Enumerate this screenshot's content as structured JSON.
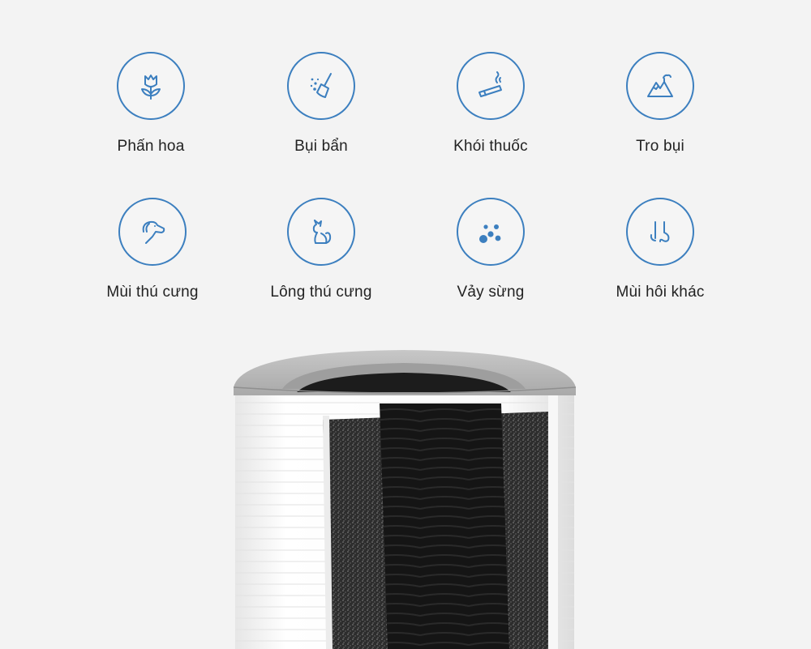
{
  "features": [
    {
      "label": "Phấn hoa",
      "icon": "flower-icon"
    },
    {
      "label": "Bụi bẩn",
      "icon": "broom-dust-icon"
    },
    {
      "label": "Khói thuốc",
      "icon": "cigarette-icon"
    },
    {
      "label": "Tro bụi",
      "icon": "mountain-ash-icon"
    },
    {
      "label": "Mùi thú cưng",
      "icon": "dog-icon"
    },
    {
      "label": "Lông thú cưng",
      "icon": "cat-icon"
    },
    {
      "label": "Vảy sừng",
      "icon": "particles-icon"
    },
    {
      "label": "Mùi hôi khác",
      "icon": "nose-icon"
    }
  ],
  "colors": {
    "icon": "#3c7fbf",
    "background": "#f3f3f3",
    "text": "#222222"
  }
}
